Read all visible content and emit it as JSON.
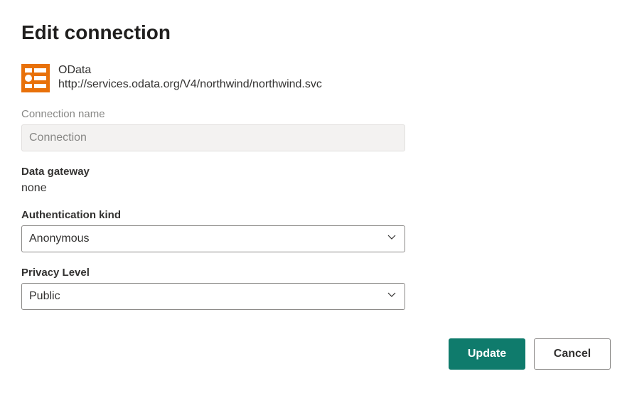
{
  "title": "Edit connection",
  "source": {
    "icon_name": "odata-source-icon",
    "title": "OData",
    "url": "http://services.odata.org/V4/northwind/northwind.svc"
  },
  "fields": {
    "connection_name": {
      "label": "Connection name",
      "placeholder": "Connection",
      "value": ""
    },
    "data_gateway": {
      "label": "Data gateway",
      "value": "none"
    },
    "authentication_kind": {
      "label": "Authentication kind",
      "selected": "Anonymous"
    },
    "privacy_level": {
      "label": "Privacy Level",
      "selected": "Public"
    }
  },
  "buttons": {
    "update": "Update",
    "cancel": "Cancel"
  }
}
